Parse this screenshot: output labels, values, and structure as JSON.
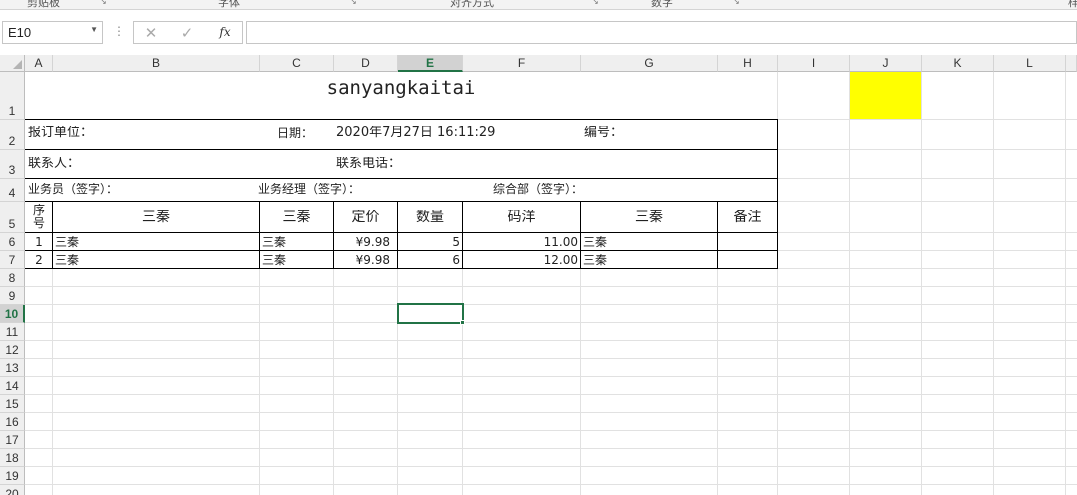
{
  "ribbon": {
    "groups": [
      {
        "id": "clipboard",
        "label": "剪贴板"
      },
      {
        "id": "font",
        "label": "字体"
      },
      {
        "id": "alignment",
        "label": "对齐方式"
      },
      {
        "id": "number",
        "label": "数字"
      },
      {
        "id": "more",
        "label": "样"
      }
    ]
  },
  "formula_bar": {
    "name_box": "E10",
    "cancel_icon": "✕",
    "enter_icon": "✓",
    "fx_label": "fx",
    "formula": ""
  },
  "columns": [
    "A",
    "B",
    "C",
    "D",
    "E",
    "F",
    "G",
    "H",
    "I",
    "J",
    "K",
    "L"
  ],
  "selected_column": "E",
  "rows": [
    "1",
    "2",
    "3",
    "4",
    "5",
    "6",
    "7",
    "8",
    "9",
    "10",
    "11",
    "12",
    "13",
    "14",
    "15",
    "16",
    "17",
    "18",
    "19",
    "20"
  ],
  "selected_row": "10",
  "sheet": {
    "title": "sanyangkaitai",
    "order_unit_label": "报订单位：",
    "date_label": "日期：",
    "date_value": "2020年7月27日 16:11:29",
    "number_label": "编号：",
    "contact_label": "联系人：",
    "phone_label": "联系电话：",
    "salesperson_label": "业务员（签字）：",
    "manager_label": "业务经理（签字）：",
    "general_dept_label": "综合部（签字）：",
    "table_headers": {
      "seq": "序号",
      "col_b": "三秦",
      "col_c": "三秦",
      "price": "定价",
      "qty": "数量",
      "discount": "码洋",
      "col_g": "三秦",
      "remark": "备注"
    },
    "table_rows": [
      {
        "seq": "1",
        "b": "三秦",
        "c": "三秦",
        "price": "¥9.98",
        "qty": "5",
        "discount": "11.00",
        "g": "三秦",
        "remark": ""
      },
      {
        "seq": "2",
        "b": "三秦",
        "c": "三秦",
        "price": "¥9.98",
        "qty": "6",
        "discount": "12.00",
        "g": "三秦",
        "remark": ""
      }
    ]
  },
  "colors": {
    "selection": "#217346",
    "highlight": "#ffff00"
  }
}
